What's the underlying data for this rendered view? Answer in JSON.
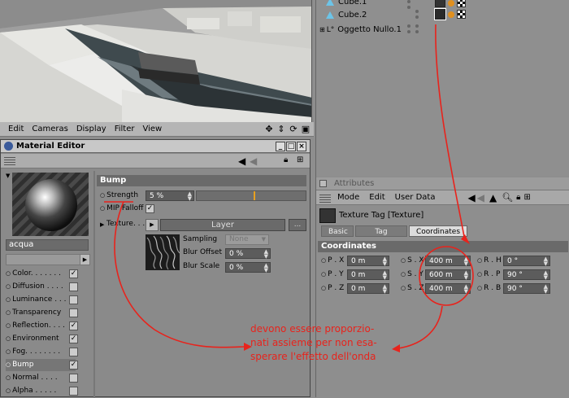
{
  "viewport": {
    "menu": [
      "Edit",
      "Cameras",
      "Display",
      "Filter",
      "View"
    ],
    "nav_icons": [
      "move-icon",
      "zoom-icon",
      "rotate-icon",
      "maximize-icon"
    ]
  },
  "object_manager": {
    "objects": [
      {
        "name": "Cube.1",
        "icon": "cube-icon"
      },
      {
        "name": "Cube.2",
        "icon": "cube-icon"
      },
      {
        "name": "Oggetto Nullo.1",
        "icon": "null-object-icon"
      }
    ]
  },
  "attributes": {
    "title": "Attributes",
    "menu": [
      "Mode",
      "Edit",
      "User Data"
    ],
    "tag_title": "Texture Tag [Texture]",
    "tabs": [
      "Basic",
      "Tag",
      "Coordinates"
    ],
    "active_tab": "Coordinates",
    "section": "Coordinates",
    "fields": {
      "px": {
        "label": "P . X",
        "value": "0 m"
      },
      "py": {
        "label": "P . Y",
        "value": "0 m"
      },
      "pz": {
        "label": "P . Z",
        "value": "0 m"
      },
      "sx": {
        "label": "S . X",
        "value": "400 m"
      },
      "sy": {
        "label": "S . Y",
        "value": "600 m"
      },
      "sz": {
        "label": "S . Z",
        "value": "400 m"
      },
      "rh": {
        "label": "R . H",
        "value": "0 °"
      },
      "rp": {
        "label": "R . P",
        "value": "90 °"
      },
      "rb": {
        "label": "R . B",
        "value": "90 °"
      }
    }
  },
  "material_editor": {
    "title": "Material Editor",
    "material_name": "acqua",
    "channels": [
      {
        "label": "Color. . . . . . .",
        "checked": true
      },
      {
        "label": "Diffusion . . . .",
        "checked": false
      },
      {
        "label": "Luminance . . .",
        "checked": false
      },
      {
        "label": "Transparency",
        "checked": false
      },
      {
        "label": "Reflection. . . .",
        "checked": true
      },
      {
        "label": "Environment",
        "checked": true
      },
      {
        "label": "Fog. . . . . . . .",
        "checked": false
      },
      {
        "label": "Bump",
        "checked": true
      },
      {
        "label": "Normal . . . .",
        "checked": false
      },
      {
        "label": "Alpha . . . . .",
        "checked": false
      }
    ],
    "bump": {
      "section": "Bump",
      "strength_label": "Strength",
      "strength_value": "5 %",
      "strength_fraction": 0.05,
      "mip_label": "MIP Falloff",
      "texture_label": "Texture. . . .",
      "layer_button": "Layer",
      "more_button": "...",
      "sampling_label": "Sampling",
      "sampling_value": "None",
      "blur_offset_label": "Blur Offset",
      "blur_offset_value": "0 %",
      "blur_scale_label": "Blur Scale",
      "blur_scale_value": "0 %"
    }
  },
  "annotation": {
    "text": "devono essere proporzio-\nnati assieme per non esa-\nsperare l'effetto dell'onda",
    "color": "#e8231c"
  }
}
